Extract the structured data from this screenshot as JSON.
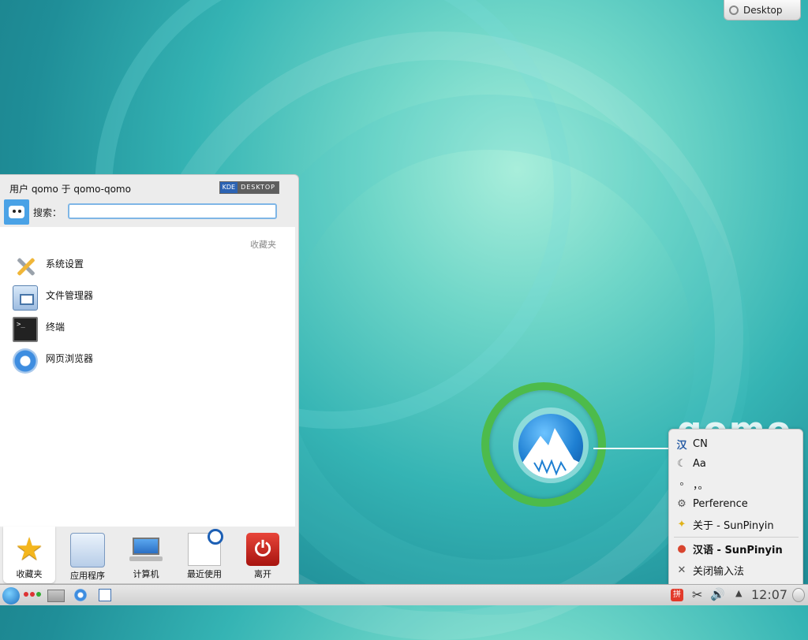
{
  "desktop": {
    "toolbox_label": "Desktop",
    "logo_text": "qomo"
  },
  "launcher": {
    "header": "用户 qomo 于 qomo-qomo",
    "kde_badge_left": "KDE",
    "kde_badge_right": "DESKTOP",
    "search_label": "搜索：",
    "search_value": "",
    "favorites_title": "收藏夹",
    "favorites": [
      {
        "label": "系统设置",
        "icon": "settings-icon"
      },
      {
        "label": "文件管理器",
        "icon": "file-manager-icon"
      },
      {
        "label": "终端",
        "icon": "terminal-icon"
      },
      {
        "label": "网页浏览器",
        "icon": "web-browser-icon"
      }
    ],
    "tabs": [
      {
        "label": "收藏夹",
        "icon": "star-icon",
        "active": true
      },
      {
        "label": "应用程序",
        "icon": "applications-icon"
      },
      {
        "label": "计算机",
        "icon": "computer-icon"
      },
      {
        "label": "最近使用",
        "icon": "recent-icon"
      },
      {
        "label": "离开",
        "icon": "leave-icon"
      }
    ]
  },
  "im_menu": {
    "items": [
      {
        "glyph": "汉",
        "label": "CN"
      },
      {
        "glyph": "☾",
        "label": "Aa"
      },
      {
        "glyph": "∘",
        "label": "，。"
      },
      {
        "glyph": "⚙",
        "label": "Perference"
      },
      {
        "glyph": "✦",
        "label": "关于 - SunPinyin"
      },
      {
        "glyph": "●",
        "label": "汉语 - SunPinyin"
      },
      {
        "glyph": "✕",
        "label": "关闭输入法"
      }
    ]
  },
  "taskbar": {
    "clock": "12:07",
    "im_indicator": "拼"
  },
  "colors": {
    "accent": "#7fb6e6",
    "leave": "#c81f16",
    "star": "#f4b61d"
  }
}
